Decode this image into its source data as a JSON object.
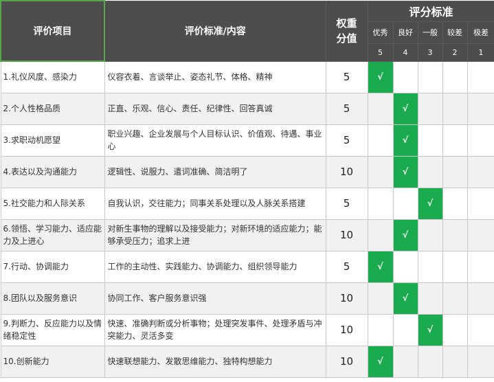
{
  "header": {
    "item": "评价项目",
    "criteria": "评价标准/内容",
    "weight": "权重分值",
    "group": "评分标准",
    "levels": [
      {
        "label": "优秀",
        "score": "5"
      },
      {
        "label": "良好",
        "score": "4"
      },
      {
        "label": "一般",
        "score": "3"
      },
      {
        "label": "较差",
        "score": "2"
      },
      {
        "label": "极差",
        "score": "1"
      }
    ]
  },
  "check_mark": "√",
  "rows": [
    {
      "item": "1.礼仪风度、感染力",
      "criteria": "仪容衣着、言谈举止、姿态礼节、体格、精神",
      "weight": "5",
      "selected": 0
    },
    {
      "item": "2.个人性格品质",
      "criteria": "正直、乐观、信心、责任、纪律性、回答真诚",
      "weight": "5",
      "selected": 1
    },
    {
      "item": "3.求职动机愿望",
      "criteria": "职业兴趣、企业发展与个人目标认识、价值观、待遇、事业心",
      "weight": "5",
      "selected": 1
    },
    {
      "item": "4.表达以及沟通能力",
      "criteria": "逻辑性、说服力、遣词准确、简洁明了",
      "weight": "10",
      "selected": 1
    },
    {
      "item": "5.社交能力和人际关系",
      "criteria": "自我认识，交往能力；同事关系处理以及人脉关系搭建",
      "weight": "5",
      "selected": 2
    },
    {
      "item": "6.领悟、学习能力、适应能力及上进心",
      "criteria": "对新生事物的理解以及接受能力；对新环境的适应能力；能够承受压力；追求上进",
      "weight": "10",
      "selected": 1
    },
    {
      "item": "7.行动、协调能力",
      "criteria": "工作的主动性、实践能力、协调能力、组织领导能力",
      "weight": "5",
      "selected": 0
    },
    {
      "item": "8.团队以及服务意识",
      "criteria": "协同工作、客户服务意识强",
      "weight": "10",
      "selected": 1
    },
    {
      "item": "9.判断力、反应能力以及情绪稳定性",
      "criteria": "快速、准确判断或分析事物；处理突发事件、处理矛盾与冲突能力、灵活多变",
      "weight": "10",
      "selected": 2
    },
    {
      "item": "10.创新能力",
      "criteria": "快速联想能力、发散思维能力、独特构想能力",
      "weight": "10",
      "selected": 0
    }
  ]
}
